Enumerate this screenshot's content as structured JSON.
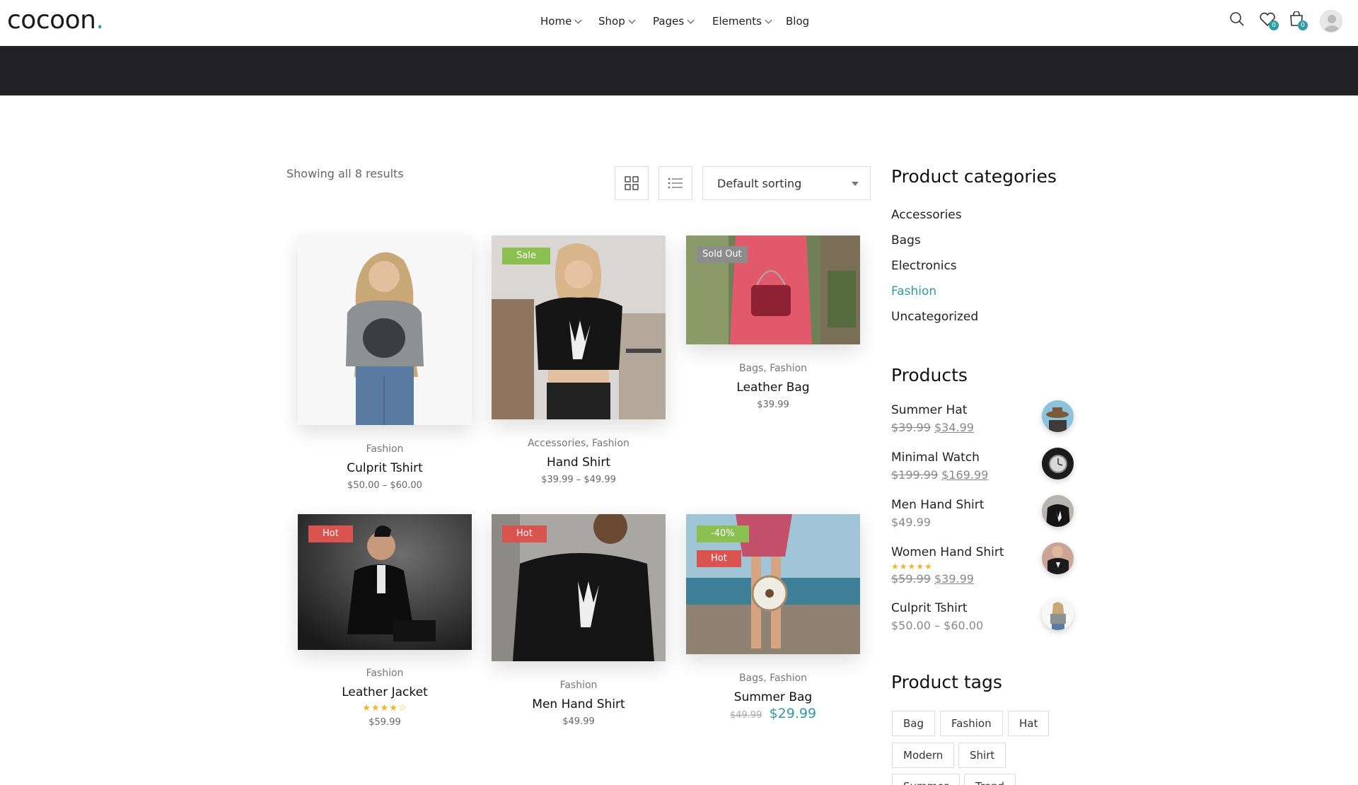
{
  "header": {
    "logo_text": "cocoon",
    "logo_dot": ".",
    "nav": [
      {
        "label": "Home",
        "has_dropdown": true
      },
      {
        "label": "Shop",
        "has_dropdown": true
      },
      {
        "label": "Pages",
        "has_dropdown": true
      },
      {
        "label": "Elements",
        "has_dropdown": true
      },
      {
        "label": "Blog",
        "has_dropdown": false
      }
    ],
    "icons": [
      "search-icon",
      "wishlist-icon",
      "cart-icon",
      "avatar"
    ],
    "wishlist_count": "0",
    "cart_count": "0"
  },
  "toolbar": {
    "result_count": "Showing all 8 results",
    "sort_label": "Default sorting"
  },
  "products": [
    {
      "category": "Fashion",
      "title": "Culprit Tshirt",
      "price": "$50.00 – $60.00",
      "badges": []
    },
    {
      "category": "Accessories, Fashion",
      "title": "Hand Shirt",
      "price": "$39.99 – $49.99",
      "badges": [
        "Sale"
      ]
    },
    {
      "category": "Bags, Fashion",
      "title": "Leather Bag",
      "price": "$39.99",
      "badges": [
        "Sold Out"
      ]
    },
    {
      "category": "Fashion",
      "title": "Leather Jacket",
      "price": "$59.99",
      "rating": 3.5,
      "badges": [
        "Hot"
      ]
    },
    {
      "category": "Fashion",
      "title": "Men Hand Shirt",
      "price": "$49.99",
      "badges": [
        "Hot"
      ]
    },
    {
      "category": "Bags, Fashion",
      "title": "Summer Bag",
      "price_old": "$49.99",
      "price_new": "$29.99",
      "badges": [
        "-40%",
        "Hot"
      ]
    }
  ],
  "sidebar": {
    "categories_title": "Product categories",
    "categories": [
      "Accessories",
      "Bags",
      "Electronics",
      "Fashion",
      "Uncategorized"
    ],
    "active_category": "Fashion",
    "products_title": "Products",
    "products": [
      {
        "name": "Summer Hat",
        "price_old": "$39.99",
        "price_new": "$34.99"
      },
      {
        "name": "Minimal Watch",
        "price_old": "$199.99",
        "price_new": "$169.99"
      },
      {
        "name": "Men Hand Shirt",
        "price": "$49.99"
      },
      {
        "name": "Women Hand Shirt",
        "rating": 5,
        "price_old": "$59.99",
        "price_new": "$39.99"
      },
      {
        "name": "Culprit Tshirt",
        "price": "$50.00 – $60.00"
      }
    ],
    "tags_title": "Product tags",
    "tags": [
      "Bag",
      "Fashion",
      "Hat",
      "Modern",
      "Shirt",
      "Summer",
      "Trend"
    ]
  },
  "colors": {
    "accent": "#2f9aa8",
    "dark_band": "#222224",
    "sale": "#8bbf50",
    "hot": "#d9534f",
    "sold_out": "#8c8c8c",
    "star": "#f0b429"
  }
}
